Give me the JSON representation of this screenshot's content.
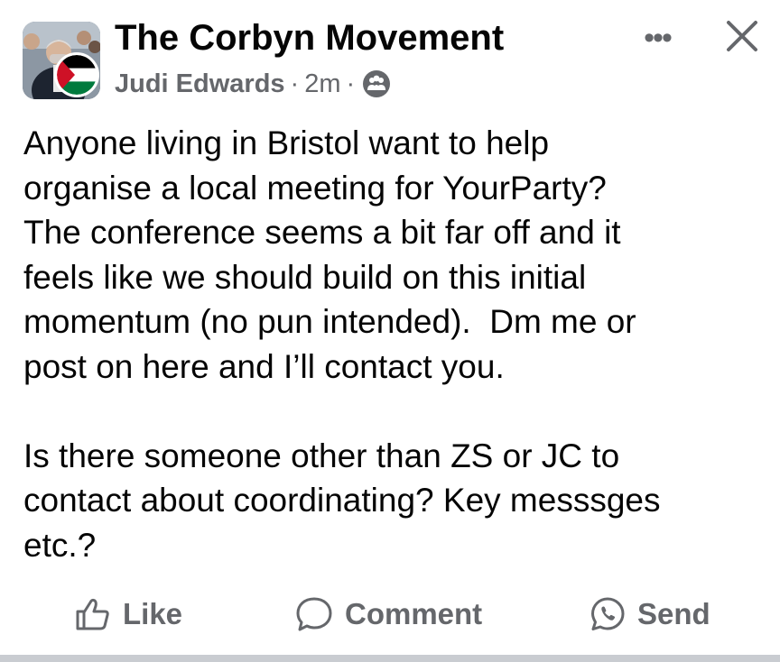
{
  "header": {
    "group_name": "The Corbyn Movement",
    "author": "Judi Edwards",
    "separator": "·",
    "time": "2m",
    "separator2": "·",
    "audience_icon": "group-members-icon",
    "more_icon": "more-options-icon",
    "more_glyph": "•••",
    "close_icon": "close-icon"
  },
  "post": {
    "body": "Anyone living in Bristol want to help\norganise a local meeting for YourParty?\nThe conference seems a bit far off and it\nfeels like we should build on this initial\nmomentum (no pun intended).  Dm me or\npost on here and I’ll contact you.\n\nIs there someone other than ZS or JC to\ncontact about coordinating? Key messsges\netc.?"
  },
  "actions": {
    "like_label": "Like",
    "comment_label": "Comment",
    "send_label": "Send"
  },
  "colors": {
    "text_primary": "#050505",
    "text_secondary": "#65676b",
    "divider": "#c9ccd1",
    "flag_red": "#ce1126",
    "flag_green": "#007a3d",
    "flag_black": "#000000"
  }
}
